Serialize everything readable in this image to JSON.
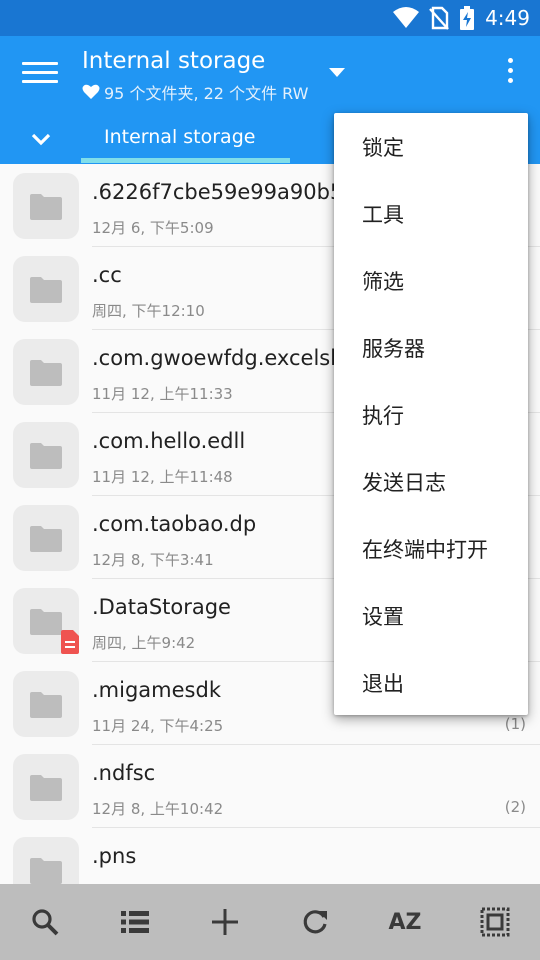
{
  "status_bar": {
    "time": "4:49",
    "icons": [
      "wifi-icon",
      "no-sim-icon",
      "battery-charging-icon"
    ]
  },
  "app_bar": {
    "title": "Internal storage",
    "subtitle": "95 个文件夹, 22 个文件 RW",
    "colors": {
      "status": "#1976d2",
      "toolbar": "#2196f3",
      "indicator": "#80deea"
    }
  },
  "tab": {
    "label": "Internal storage"
  },
  "files": [
    {
      "name": ".6226f7cbe59e99a90b5",
      "date": "12月 6, 下午5:09",
      "count": ""
    },
    {
      "name": ".cc",
      "date": "周四, 下午12:10",
      "count": ""
    },
    {
      "name": ".com.gwoewfdg.excelsh",
      "date": "11月 12, 上午11:33",
      "count": ""
    },
    {
      "name": ".com.hello.edll",
      "date": "11月 12, 上午11:48",
      "count": ""
    },
    {
      "name": ".com.taobao.dp",
      "date": "12月 8, 下午3:41",
      "count": ""
    },
    {
      "name": ".DataStorage",
      "date": "周四, 上午9:42",
      "count": "",
      "badge": "document-badge-icon"
    },
    {
      "name": ".migamesdk",
      "date": "11月 24, 下午4:25",
      "count": "(1)"
    },
    {
      "name": ".ndfsc",
      "date": "12月 8, 上午10:42",
      "count": "(2)"
    },
    {
      "name": ".pns",
      "date": "",
      "count": ""
    }
  ],
  "menu": {
    "items": [
      "锁定",
      "工具",
      "筛选",
      "服务器",
      "执行",
      "发送日志",
      "在终端中打开",
      "设置",
      "退出"
    ]
  },
  "bottom_bar": {
    "items": [
      "search-icon",
      "list-view-icon",
      "add-icon",
      "refresh-icon",
      "sort-icon",
      "select-all-icon"
    ],
    "sort_label": "AZ"
  }
}
